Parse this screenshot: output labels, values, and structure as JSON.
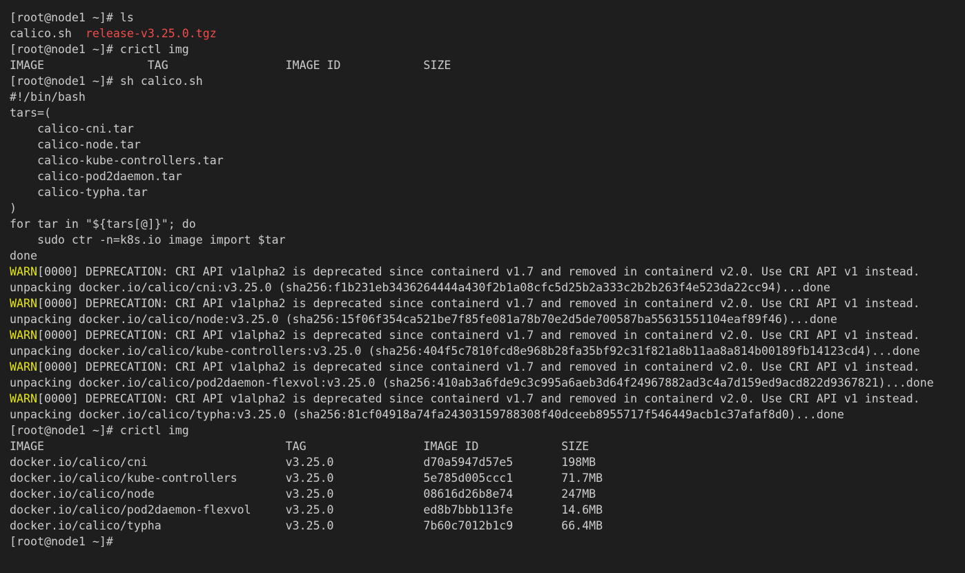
{
  "terminal": {
    "colors": {
      "background": "#1e1e1e",
      "foreground": "#cccccc",
      "warn": "#e5e510",
      "archive": "#f14c4c"
    },
    "lines": [
      [
        {
          "t": "[root@node1 ~]# ls"
        }
      ],
      [
        {
          "t": "calico.sh  "
        },
        {
          "t": "release-v3.25.0.tgz",
          "c": "archive"
        }
      ],
      [
        {
          "t": "[root@node1 ~]# crictl img"
        }
      ],
      [
        {
          "t": "IMAGE               TAG                 IMAGE ID            SIZE"
        }
      ],
      [
        {
          "t": "[root@node1 ~]# sh calico.sh"
        }
      ],
      [
        {
          "t": "#!/bin/bash"
        }
      ],
      [
        {
          "t": "tars=("
        }
      ],
      [
        {
          "t": "    calico-cni.tar"
        }
      ],
      [
        {
          "t": "    calico-node.tar"
        }
      ],
      [
        {
          "t": "    calico-kube-controllers.tar"
        }
      ],
      [
        {
          "t": "    calico-pod2daemon.tar"
        }
      ],
      [
        {
          "t": "    calico-typha.tar"
        }
      ],
      [
        {
          "t": ")"
        }
      ],
      [
        {
          "t": "for tar in \"${tars[@]}\"; do"
        }
      ],
      [
        {
          "t": "    sudo ctr -n=k8s.io image import $tar"
        }
      ],
      [
        {
          "t": "done"
        }
      ],
      [
        {
          "t": "WARN",
          "c": "warn"
        },
        {
          "t": "[0000] DEPRECATION: CRI API v1alpha2 is deprecated since containerd v1.7 and removed in containerd v2.0. Use CRI API v1 instead."
        }
      ],
      [
        {
          "t": "unpacking docker.io/calico/cni:v3.25.0 (sha256:f1b231eb3436264444a430f2b1a08cfc5d25b2a333c2b2b263f4e523da22cc94)...done"
        }
      ],
      [
        {
          "t": "WARN",
          "c": "warn"
        },
        {
          "t": "[0000] DEPRECATION: CRI API v1alpha2 is deprecated since containerd v1.7 and removed in containerd v2.0. Use CRI API v1 instead."
        }
      ],
      [
        {
          "t": "unpacking docker.io/calico/node:v3.25.0 (sha256:15f06f354ca521be7f85fe081a78b70e2d5de700587ba55631551104eaf89f46)...done"
        }
      ],
      [
        {
          "t": "WARN",
          "c": "warn"
        },
        {
          "t": "[0000] DEPRECATION: CRI API v1alpha2 is deprecated since containerd v1.7 and removed in containerd v2.0. Use CRI API v1 instead."
        }
      ],
      [
        {
          "t": "unpacking docker.io/calico/kube-controllers:v3.25.0 (sha256:404f5c7810fcd8e968b28fa35bf92c31f821a8b11aa8a814b00189fb14123cd4)...done"
        }
      ],
      [
        {
          "t": "WARN",
          "c": "warn"
        },
        {
          "t": "[0000] DEPRECATION: CRI API v1alpha2 is deprecated since containerd v1.7 and removed in containerd v2.0. Use CRI API v1 instead."
        }
      ],
      [
        {
          "t": "unpacking docker.io/calico/pod2daemon-flexvol:v3.25.0 (sha256:410ab3a6fde9c3c995a6aeb3d64f24967882ad3c4a7d159ed9acd822d9367821)...done"
        }
      ],
      [
        {
          "t": "WARN",
          "c": "warn"
        },
        {
          "t": "[0000] DEPRECATION: CRI API v1alpha2 is deprecated since containerd v1.7 and removed in containerd v2.0. Use CRI API v1 instead."
        }
      ],
      [
        {
          "t": "unpacking docker.io/calico/typha:v3.25.0 (sha256:81cf04918a74fa24303159788308f40dceeb8955717f546449acb1c37afaf8d0)...done"
        }
      ],
      [
        {
          "t": "[root@node1 ~]# crictl img"
        }
      ],
      [
        {
          "t": "IMAGE                                   TAG                 IMAGE ID            SIZE"
        }
      ],
      [
        {
          "t": "docker.io/calico/cni                    v3.25.0             d70a5947d57e5       198MB"
        }
      ],
      [
        {
          "t": "docker.io/calico/kube-controllers       v3.25.0             5e785d005ccc1       71.7MB"
        }
      ],
      [
        {
          "t": "docker.io/calico/node                   v3.25.0             08616d26b8e74       247MB"
        }
      ],
      [
        {
          "t": "docker.io/calico/pod2daemon-flexvol     v3.25.0             ed8b7bbb113fe       14.6MB"
        }
      ],
      [
        {
          "t": "docker.io/calico/typha                  v3.25.0             7b60c7012b1c9       66.4MB"
        }
      ],
      [
        {
          "t": "[root@node1 ~]# "
        }
      ]
    ]
  }
}
